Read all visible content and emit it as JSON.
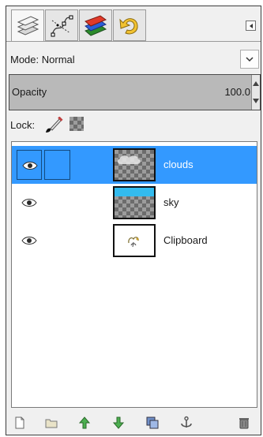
{
  "tabs": [
    {
      "icon": "layers-icon",
      "active": true
    },
    {
      "icon": "paths-icon",
      "active": false
    },
    {
      "icon": "channels-icon",
      "active": false
    },
    {
      "icon": "undo-history-icon",
      "active": false
    }
  ],
  "tab_menu_icon": "tab-menu-icon",
  "mode": {
    "label": "Mode: Normal",
    "dropdown_icon": "chevron-down-icon"
  },
  "opacity": {
    "label": "Opacity",
    "value": "100.0"
  },
  "lock": {
    "label": "Lock:",
    "icons": [
      "lock-pixels-brush-icon",
      "lock-alpha-checker-icon"
    ]
  },
  "layers": [
    {
      "name": "clouds",
      "selected": true,
      "visible": true,
      "thumb": "clouds-transparent"
    },
    {
      "name": "sky",
      "selected": false,
      "visible": true,
      "thumb": "sky-blue-strip"
    },
    {
      "name": "Clipboard",
      "selected": false,
      "visible": true,
      "thumb": "clipboard-sketch"
    }
  ],
  "toolbar": [
    "new-layer-icon",
    "layer-group-icon",
    "raise-layer-icon",
    "lower-layer-icon",
    "duplicate-layer-icon",
    "anchor-layer-icon",
    "delete-layer-icon"
  ],
  "colors": {
    "selection": "#3399ff",
    "sky_blue": "#33bbee"
  }
}
